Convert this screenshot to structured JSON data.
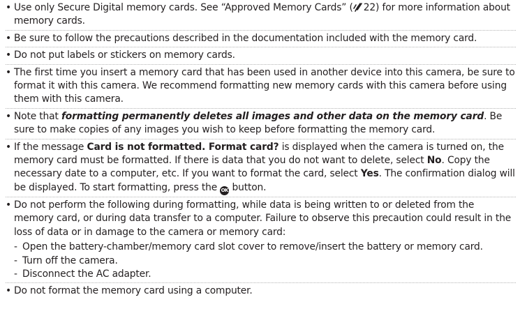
{
  "bullet_symbol": "•",
  "dash_symbol": "-",
  "items": [
    {
      "pre": "Use only Secure Digital memory cards. See “Approved Memory Cards” (",
      "ref_page": "22",
      "ref_icon": "reference-page-icon",
      "post": ") for more information about memory cards."
    },
    {
      "text": "Be sure to follow the precautions described in the documentation included with the memory card."
    },
    {
      "text": "Do not put labels or stickers on memory cards."
    },
    {
      "text": "The first time you insert a memory card that has been used in another device into this camera, be sure to format it with this camera. We recommend formatting new memory cards with this camera before using them with this camera."
    },
    {
      "pre": "Note that ",
      "emphasis": "formatting permanently deletes all images and other data on the memory card",
      "post": ". Be sure to make copies of any images you wish to keep before formatting the memory card."
    },
    {
      "t1": "If the message ",
      "b1": "Card is not formatted. Format card?",
      "t2": " is displayed when the camera is turned on, the memory card must be formatted. If there is data that you do not want to delete, select ",
      "b2": "No",
      "t3": ". Copy the necessary date to a computer, etc. If you want to format the card, select ",
      "b3": "Yes",
      "t4": ". The confirmation dialog will be displayed. To start formatting, press the ",
      "ok_label": "OK",
      "ok_icon": "ok-button-icon",
      "t5": " button."
    },
    {
      "text": "Do not perform the following during formatting, while data is being written to or deleted from the memory card, or during data transfer to a computer. Failure to observe this precaution could result in the loss of data or in damage to the camera or memory card:",
      "sub": [
        "Open the battery-chamber/memory card slot cover to remove/insert the battery or memory card.",
        "Turn off the camera.",
        "Disconnect the AC adapter."
      ]
    },
    {
      "text": "Do not format the memory card using a computer."
    }
  ]
}
